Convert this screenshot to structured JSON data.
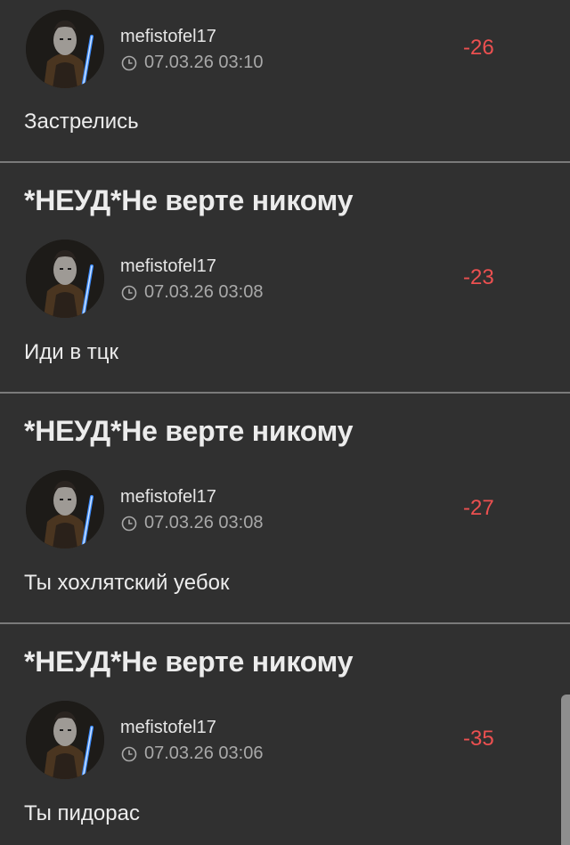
{
  "posts": [
    {
      "title": "",
      "author": "mefistofel17",
      "timestamp": "07.03.26 03:10",
      "score": "-26",
      "text": "Застрелись"
    },
    {
      "title": "*НЕУД*Не верте никому",
      "author": "mefistofel17",
      "timestamp": "07.03.26 03:08",
      "score": "-23",
      "text": "Иди в тцк"
    },
    {
      "title": "*НЕУД*Не верте никому",
      "author": "mefistofel17",
      "timestamp": "07.03.26 03:08",
      "score": "-27",
      "text": "Ты хохлятский уебок"
    },
    {
      "title": "*НЕУД*Не верте никому",
      "author": "mefistofel17",
      "timestamp": "07.03.26 03:06",
      "score": "-35",
      "text": "Ты пидорас"
    }
  ],
  "colors": {
    "background": "#303030",
    "score_negative": "#ec5050",
    "separator": "#7a7a7a",
    "lightsaber": "#3b8cff"
  },
  "icons": {
    "timestamp": "clock-icon",
    "avatar": "user-avatar-jedi"
  }
}
